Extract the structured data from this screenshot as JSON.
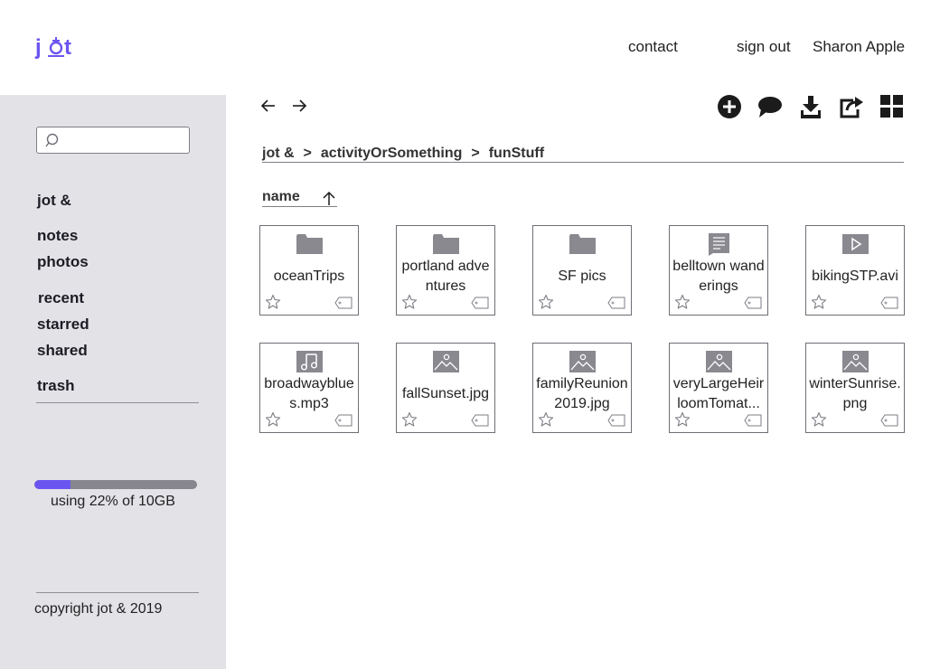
{
  "header": {
    "logo_text": "jot &",
    "nav": {
      "contact": "contact",
      "sign_out": "sign out",
      "user": "Sharon Apple"
    }
  },
  "sidebar": {
    "search_placeholder": "",
    "brand": "jot &",
    "items": [
      "notes",
      "photos",
      "recent",
      "starred",
      "shared",
      "trash"
    ],
    "storage": {
      "used_fraction": 0.22,
      "label": "using 22% of 10GB"
    },
    "copyright": "copyright jot & 2019"
  },
  "toolbar": {
    "icons": [
      "back-arrow-icon",
      "forward-arrow-icon",
      "add-icon",
      "comment-icon",
      "download-icon",
      "share-icon",
      "grid-view-icon"
    ]
  },
  "breadcrumb": [
    "jot &",
    "activityOrSomething",
    "funStuff"
  ],
  "breadcrumb_separator": ">",
  "sort": {
    "label": "name",
    "direction": "ascending"
  },
  "files": [
    {
      "name": "oceanTrips",
      "type": "folder"
    },
    {
      "name": "portland adventures",
      "type": "folder"
    },
    {
      "name": "SF pics",
      "type": "folder"
    },
    {
      "name": "belltown wanderings",
      "type": "document"
    },
    {
      "name": "bikingSTP.avi",
      "type": "video"
    },
    {
      "name": "broadwayblues.mp3",
      "type": "audio"
    },
    {
      "name": "fallSunset.jpg",
      "type": "image"
    },
    {
      "name": "familyReunion2019.jpg",
      "type": "image"
    },
    {
      "name": "veryLargeHeirloomTomat...",
      "type": "image"
    },
    {
      "name": "winterSunrise.png",
      "type": "image"
    }
  ],
  "colors": {
    "accent": "#6b55f0",
    "sidebar_bg": "#e3e2e7",
    "icon_gray": "#8a8990",
    "icon_dark": "#1b1b1b"
  }
}
